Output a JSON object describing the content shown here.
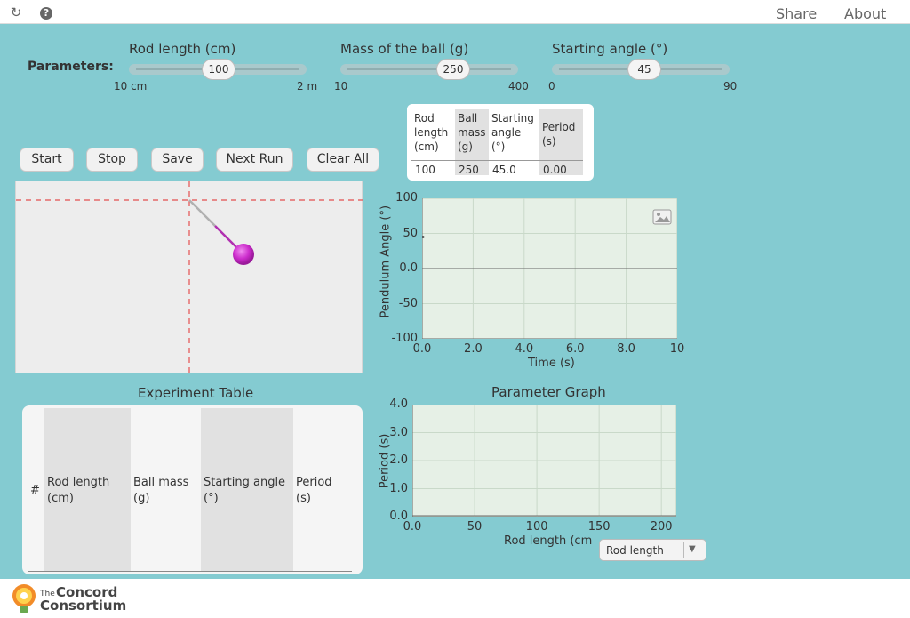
{
  "topbar": {
    "share_label": "Share",
    "about_label": "About"
  },
  "parameters": {
    "label": "Parameters:",
    "rod_length": {
      "title": "Rod length (cm)",
      "value": "100",
      "min_label": "10 cm",
      "max_label": "2 m"
    },
    "mass": {
      "title": "Mass of the ball (g)",
      "value": "250",
      "min_label": "10",
      "max_label": "400"
    },
    "angle": {
      "title": "Starting angle (°)",
      "value": "45",
      "min_label": "0",
      "max_label": "90"
    }
  },
  "controls": {
    "start": "Start",
    "stop": "Stop",
    "save": "Save",
    "next_run": "Next Run",
    "clear_all": "Clear All"
  },
  "current_run_table": {
    "headers": [
      "Rod\nlength\n(cm)",
      "Ball\nmass\n(g)",
      "Starting\nangle\n(°)",
      "Period\n(s)"
    ],
    "values": [
      "100",
      "250",
      "45.0",
      "0.00"
    ]
  },
  "angle_graph": {
    "ylabel": "Pendulum Angle (°)",
    "xlabel": "Time (s)",
    "yticks": [
      "100",
      "50",
      "0.0",
      "-50",
      "-100"
    ],
    "xticks": [
      "0.0",
      "2.0",
      "4.0",
      "6.0",
      "8.0",
      "10"
    ]
  },
  "experiment_table": {
    "title": "Experiment Table",
    "headers": [
      "#",
      "Rod length\n(cm)",
      "Ball mass\n(g)",
      "Starting angle\n(°)",
      "Period\n(s)"
    ]
  },
  "parameter_graph": {
    "title": "Parameter Graph",
    "ylabel": "Period (s)",
    "xlabel": "Rod length (cm",
    "yticks": [
      "4.0",
      "3.0",
      "2.0",
      "1.0",
      "0.0"
    ],
    "xticks": [
      "0.0",
      "50",
      "100",
      "150",
      "200"
    ],
    "x_select": "Rod length"
  },
  "footer": {
    "logo_text_small": "The",
    "logo_text_1": "Concord",
    "logo_text_2": "Consortium"
  },
  "chart_data": [
    {
      "type": "line",
      "title": "",
      "xlabel": "Time (s)",
      "ylabel": "Pendulum Angle (°)",
      "xlim": [
        0,
        10
      ],
      "ylim": [
        -100,
        100
      ],
      "grid": true,
      "series": [
        {
          "x": [
            0.0
          ],
          "y": [
            45
          ]
        }
      ]
    },
    {
      "type": "scatter",
      "title": "Parameter Graph",
      "xlabel": "Rod length (cm",
      "ylabel": "Period (s)",
      "xlim": [
        0,
        200
      ],
      "ylim": [
        0,
        4
      ],
      "grid": true,
      "series": []
    }
  ],
  "colors": {
    "background": "#84cbd1",
    "ball": "#cc33cc",
    "rod": "#aaaaaa",
    "guide": "#e45050",
    "graph_bg": "#e6f0e6"
  }
}
